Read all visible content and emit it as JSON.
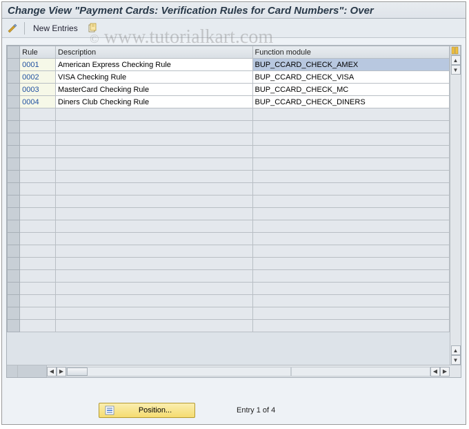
{
  "title": "Change View \"Payment Cards: Verification Rules for Card Numbers\": Over",
  "watermark": "www.tutorialkart.com",
  "toolbar": {
    "new_entries_label": "New Entries"
  },
  "table": {
    "columns": {
      "rule": "Rule",
      "description": "Description",
      "function_module": "Function module"
    },
    "rows": [
      {
        "rule": "0001",
        "description": "American Express Checking Rule",
        "function_module": "BUP_CCARD_CHECK_AMEX",
        "selected": true
      },
      {
        "rule": "0002",
        "description": "VISA Checking Rule",
        "function_module": "BUP_CCARD_CHECK_VISA"
      },
      {
        "rule": "0003",
        "description": "MasterCard Checking Rule",
        "function_module": "BUP_CCARD_CHECK_MC"
      },
      {
        "rule": "0004",
        "description": "Diners Club Checking Rule",
        "function_module": "BUP_CCARD_CHECK_DINERS"
      }
    ]
  },
  "footer": {
    "position_label": "Position...",
    "status": "Entry 1 of 4"
  },
  "chart_data": {
    "type": "table",
    "title": "Payment Cards: Verification Rules for Card Numbers",
    "columns": [
      "Rule",
      "Description",
      "Function module"
    ],
    "rows": [
      [
        "0001",
        "American Express Checking Rule",
        "BUP_CCARD_CHECK_AMEX"
      ],
      [
        "0002",
        "VISA Checking Rule",
        "BUP_CCARD_CHECK_VISA"
      ],
      [
        "0003",
        "MasterCard Checking Rule",
        "BUP_CCARD_CHECK_MC"
      ],
      [
        "0004",
        "Diners Club Checking Rule",
        "BUP_CCARD_CHECK_DINERS"
      ]
    ]
  }
}
